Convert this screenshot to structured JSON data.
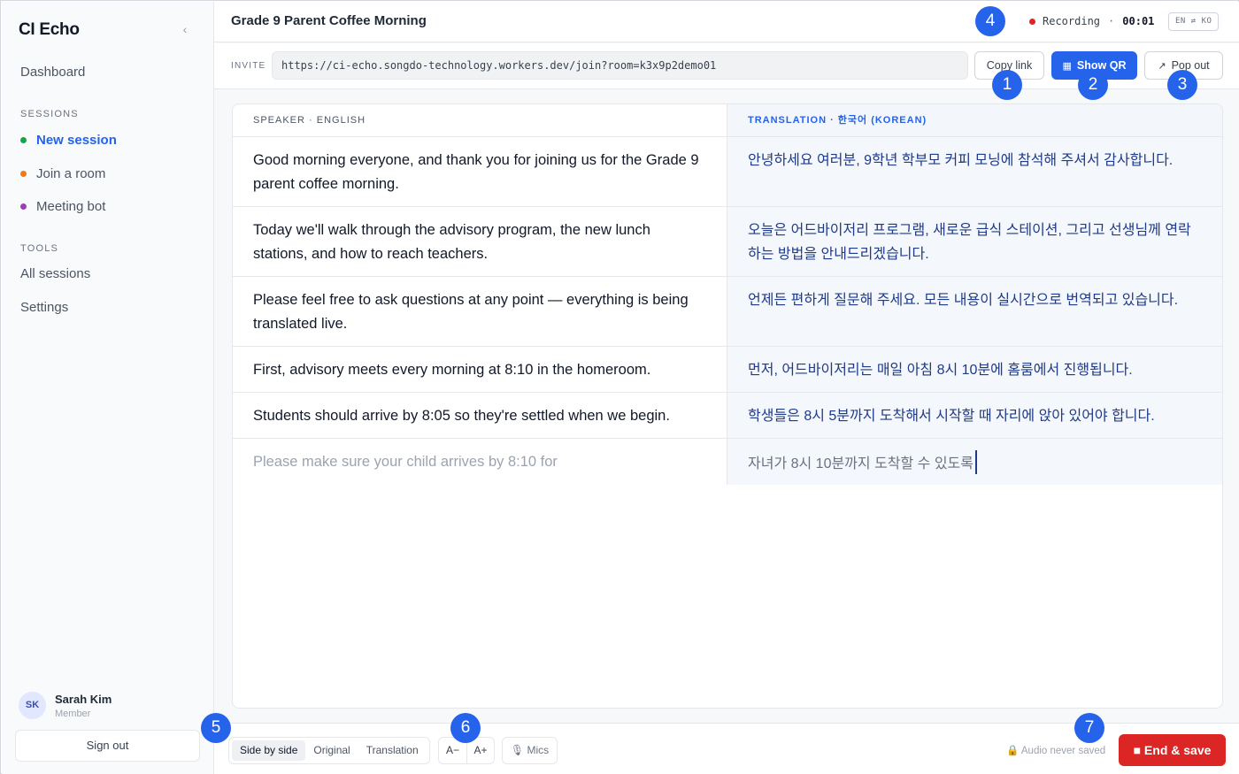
{
  "sidebar": {
    "brand": "CI Echo",
    "collapse_icon": "‹",
    "dashboard": "Dashboard",
    "sessions_title": "SESSIONS",
    "sessions": [
      {
        "label": "New session",
        "color": "#16a34a"
      },
      {
        "label": "Join a room",
        "color": "#ea7a1e"
      },
      {
        "label": "Meeting bot",
        "color": "#9b3fb6"
      }
    ],
    "tools_title": "TOOLS",
    "tools": [
      "All sessions",
      "Settings"
    ],
    "user": {
      "initials": "SK",
      "name": "Sarah Kim",
      "role": "Member"
    },
    "sign_out": "Sign out"
  },
  "header": {
    "title": "Grade 9 Parent Coffee Morning",
    "recording_label": "Recording",
    "separator": "·",
    "recording_time": "00:01",
    "lang_pair": "EN ⇄ KO"
  },
  "invite": {
    "label": "INVITE",
    "url": "https://ci-echo.songdo-technology.workers.dev/join?room=k3x9p2demo01",
    "copy_link": "Copy link",
    "show_qr": "Show QR",
    "pop_out": "Pop out"
  },
  "transcript": {
    "left_header": "SPEAKER · ENGLISH",
    "right_header": "TRANSLATION · 한국어 (KOREAN)",
    "rows": [
      {
        "source": "Good morning everyone, and thank you for joining us for the Grade 9 parent coffee morning.",
        "translation": "안녕하세요 여러분, 9학년 학부모 커피 모닝에 참석해 주셔서 감사합니다."
      },
      {
        "source": "Today we'll walk through the advisory program, the new lunch stations, and how to reach teachers.",
        "translation": "오늘은 어드바이저리 프로그램, 새로운 급식 스테이션, 그리고 선생님께 연락하는 방법을 안내드리겠습니다."
      },
      {
        "source": "Please feel free to ask questions at any point — everything is being translated live.",
        "translation": "언제든 편하게 질문해 주세요. 모든 내용이 실시간으로 번역되고 있습니다."
      },
      {
        "source": "First, advisory meets every morning at 8:10 in the homeroom.",
        "translation": "먼저, 어드바이저리는 매일 아침 8시 10분에 홈룸에서 진행됩니다."
      },
      {
        "source": "Students should arrive by 8:05 so they're settled when we begin.",
        "translation": "학생들은 8시 5분까지 도착해서 시작할 때 자리에 앉아 있어야 합니다."
      },
      {
        "source": "Please make sure your child arrives by 8:10 for",
        "translation": "자녀가 8시 10분까지 도착할 수 있도록"
      }
    ]
  },
  "toolbar": {
    "view_modes": [
      "Side by side",
      "Original",
      "Translation"
    ],
    "font_down": "A−",
    "font_up": "A+",
    "mics": "Mics",
    "audio_note": "Audio never saved",
    "end_save": "■ End & save"
  },
  "badges": [
    "1",
    "2",
    "3",
    "4",
    "5",
    "6",
    "7"
  ],
  "colors": {
    "accent": "#2563eb",
    "danger": "#dc2626"
  }
}
